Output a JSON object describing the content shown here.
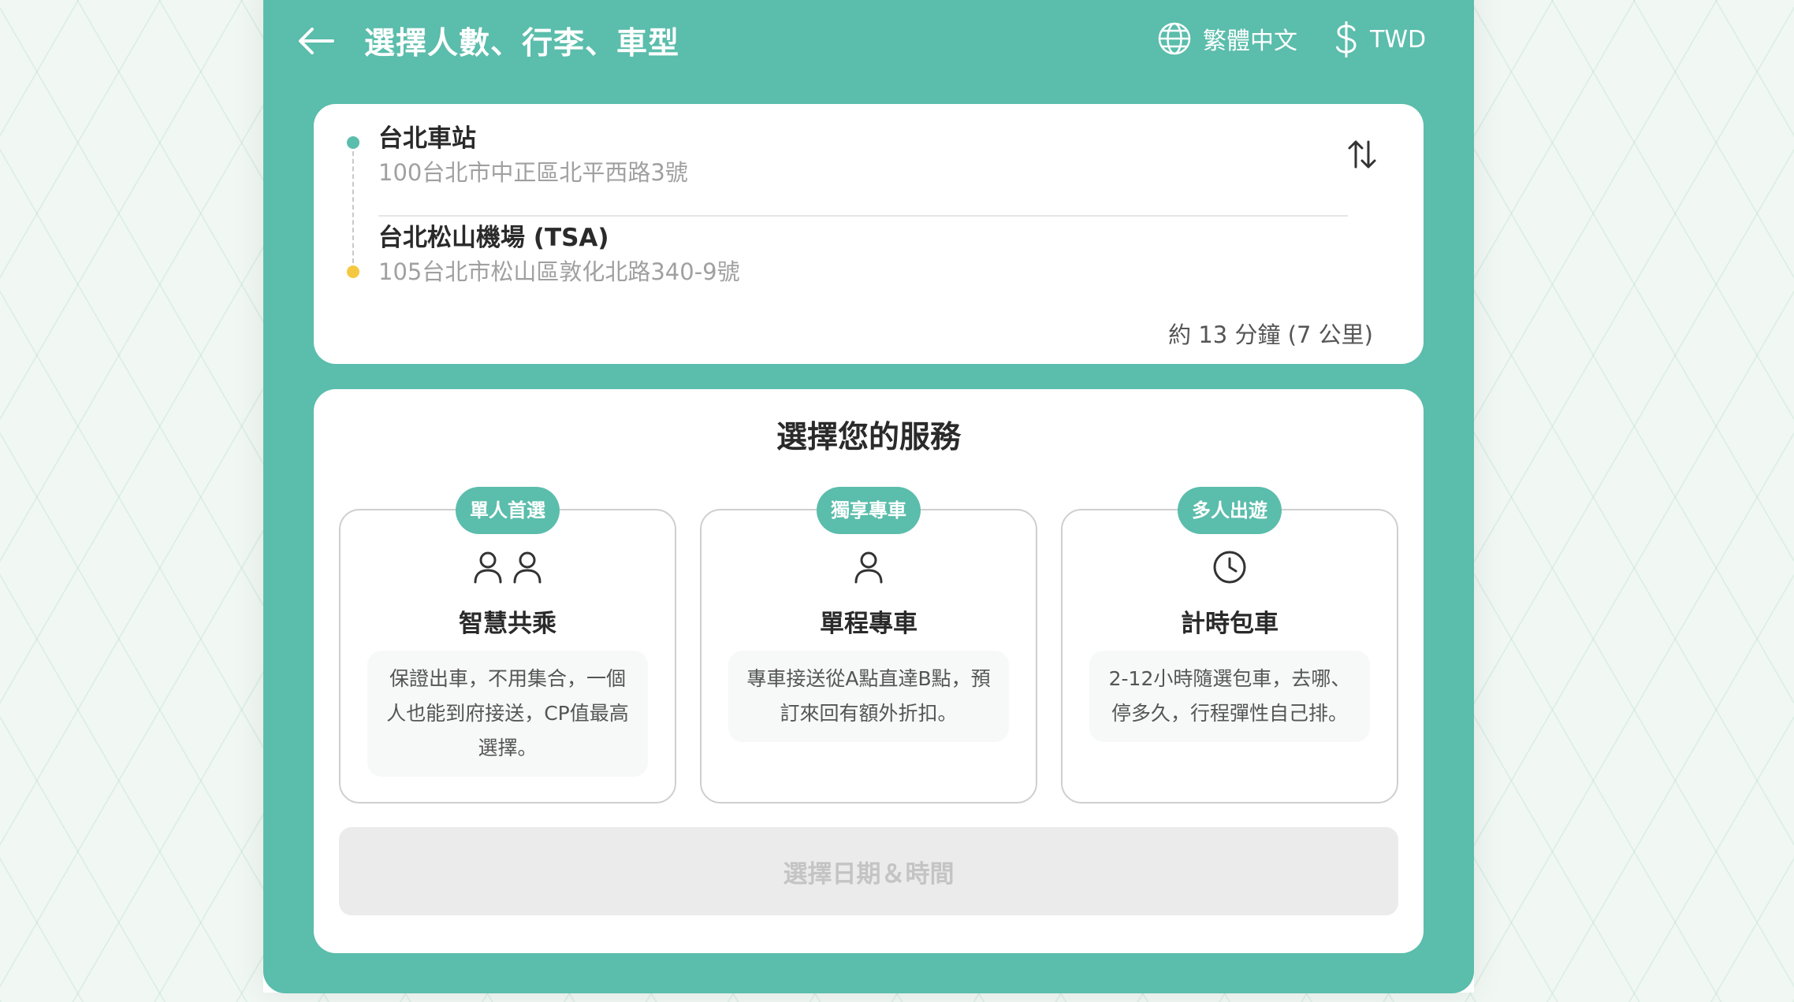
{
  "header": {
    "title": "選擇人數、行李、車型",
    "language_label": "繁體中文",
    "currency_label": "TWD"
  },
  "route": {
    "origin": {
      "name": "台北車站",
      "address": "100台北市中正區北平西路3號"
    },
    "destination": {
      "name": "台北松山機場 (TSA)",
      "address": "105台北市松山區敦化北路340-9號"
    },
    "trip_info": "約 13 分鐘 (7 公里)"
  },
  "services": {
    "title": "選擇您的服務",
    "options": [
      {
        "badge": "單人首選",
        "name": "智慧共乘",
        "icon": "two-persons-icon",
        "description": "保證出車，不用集合，一個人也能到府接送，CP值最高選擇。"
      },
      {
        "badge": "獨享專車",
        "name": "單程專車",
        "icon": "person-icon",
        "description": "專車接送從A點直達B點，預訂來回有額外折扣。"
      },
      {
        "badge": "多人出遊",
        "name": "計時包車",
        "icon": "clock-icon",
        "description": "2-12小時隨選包車，去哪、停多久，行程彈性自己排。"
      }
    ],
    "cta_label": "選擇日期＆時間"
  },
  "colors": {
    "brand": "#5bbdab",
    "origin_dot": "#5bbdab",
    "destination_dot": "#f5c842"
  }
}
